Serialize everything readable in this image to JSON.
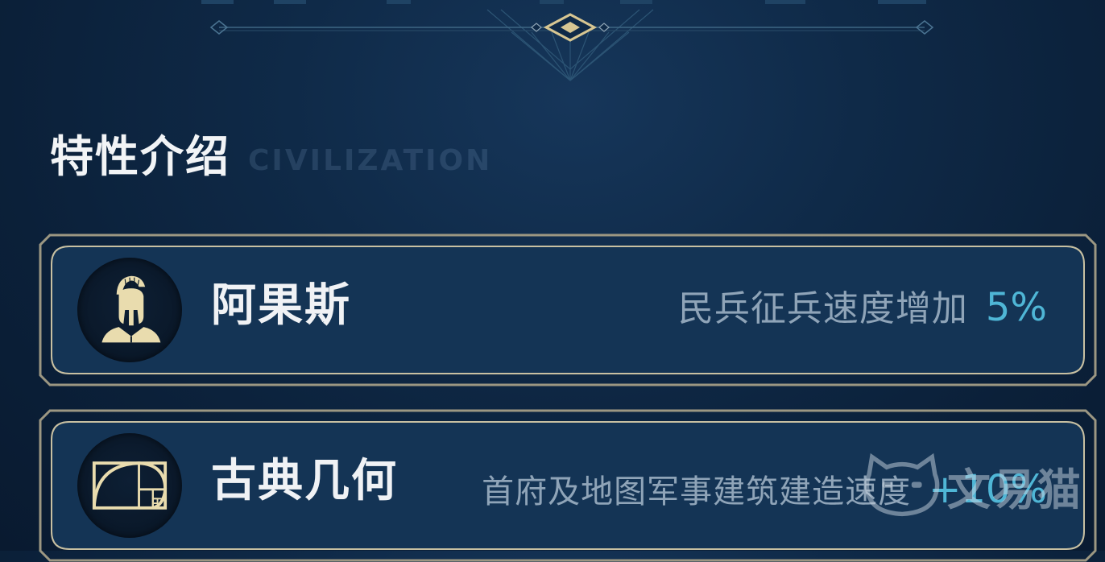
{
  "section": {
    "title": "特性介绍",
    "watermark": "CIVILIZATION"
  },
  "traits": [
    {
      "icon": "spartan-helmet-icon",
      "name": "阿果斯",
      "effect": "民兵征兵速度增加",
      "value": "5%"
    },
    {
      "icon": "golden-spiral-icon",
      "name": "古典几何",
      "effect": "首府及地图军事建筑建造速度",
      "value": "+10%"
    }
  ],
  "site_watermark": "文易猫",
  "colors": {
    "background": "#0f2a48",
    "frame_gold": "#b7ad90",
    "accent_blue": "#4fb6d6",
    "icon_gold": "#e9dcae"
  }
}
